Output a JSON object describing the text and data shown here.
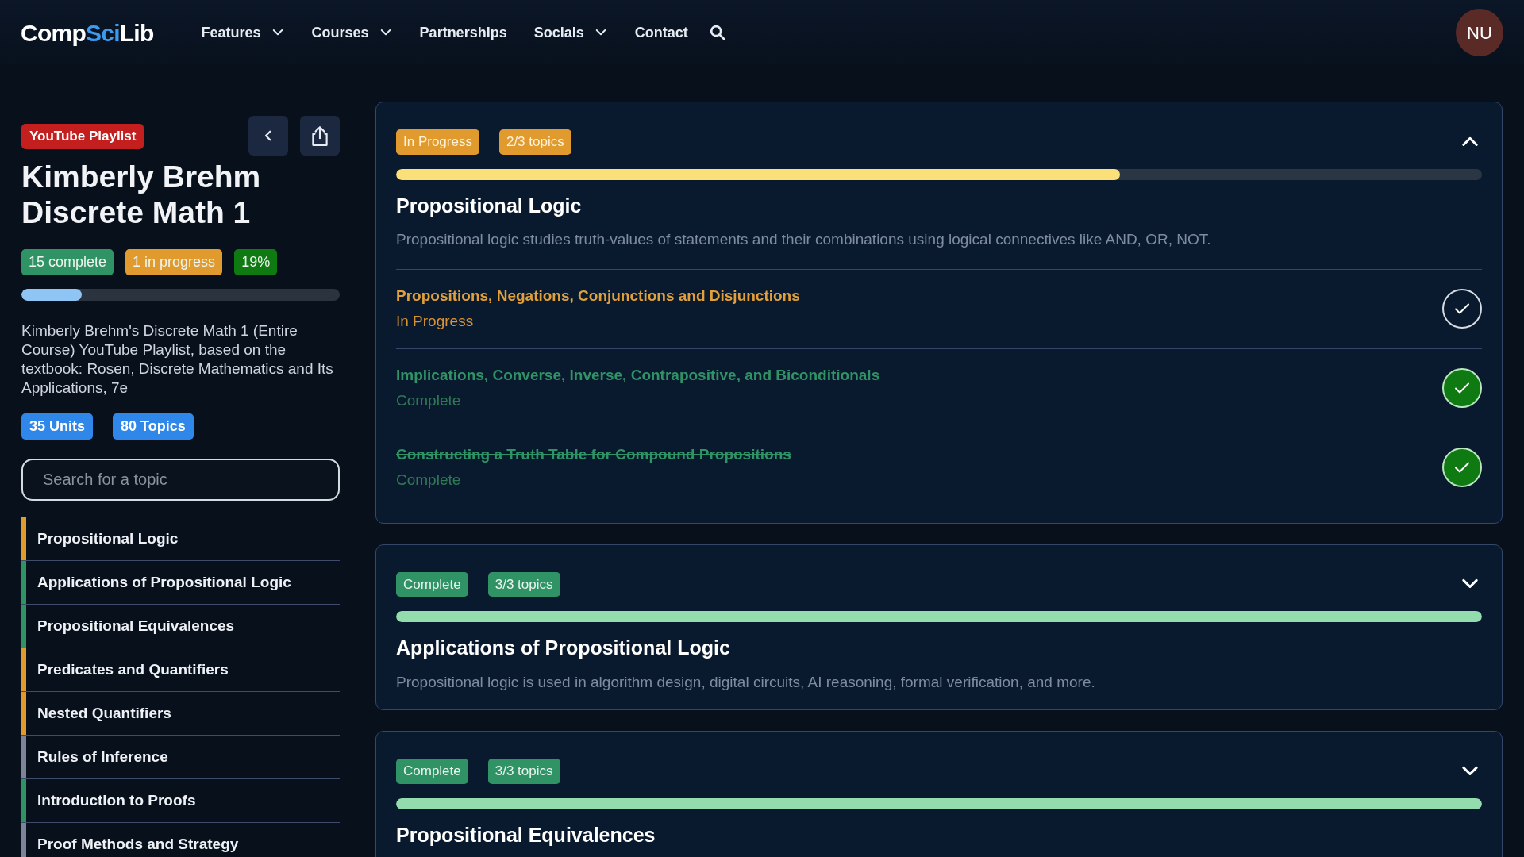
{
  "header": {
    "logo": [
      "Comp",
      "Sci",
      "Lib"
    ],
    "nav": [
      {
        "label": "Features",
        "dropdown": true
      },
      {
        "label": "Courses",
        "dropdown": true
      },
      {
        "label": "Partnerships",
        "dropdown": false
      },
      {
        "label": "Socials",
        "dropdown": true
      },
      {
        "label": "Contact",
        "dropdown": false
      }
    ],
    "avatar": "NU"
  },
  "sidebar": {
    "badge": "YouTube Playlist",
    "title": "Kimberly Brehm Discrete Math 1",
    "stats": [
      {
        "label": "15 complete",
        "color": "#2f9366"
      },
      {
        "label": "1 in progress",
        "color": "#e09a2e"
      },
      {
        "label": "19%",
        "color": "#0f7a12"
      }
    ],
    "level": 0.19,
    "description": "Kimberly Brehm's Discrete Math 1 (Entire Course) YouTube Playlist, based on the textbook: Rosen, Discrete Mathematics and Its Applications, 7e",
    "counts": [
      "35 Units",
      "80 Topics"
    ],
    "search": {
      "placeholder": "Search for a topic"
    },
    "items": [
      {
        "label": "Propositional Logic",
        "color": "#e09a2e"
      },
      {
        "label": "Applications of Propositional Logic",
        "color": "#2f9366"
      },
      {
        "label": "Propositional Equivalences",
        "color": "#2f9366"
      },
      {
        "label": "Predicates and Quantifiers",
        "color": "#e09a2e"
      },
      {
        "label": "Nested Quantifiers",
        "color": "#e09a2e"
      },
      {
        "label": "Rules of Inference",
        "color": "#7b8597"
      },
      {
        "label": "Introduction to Proofs",
        "color": "#2f9366"
      },
      {
        "label": "Proof Methods and Strategy",
        "color": "#7b8597"
      }
    ]
  },
  "units": [
    {
      "kind": "in_progress",
      "status_label": "In Progress",
      "count": "2/3 topics",
      "level": 0.667,
      "expanded": true,
      "title": "Propositional Logic",
      "description": "Propositional logic studies truth-values of statements and their combinations using logical connectives like AND, OR, NOT.",
      "topics": [
        {
          "title": "Propositions, Negations, Conjunctions and Disjunctions",
          "kind": "in_progress",
          "status_label": "In Progress"
        },
        {
          "title": "Implications, Converse, Inverse, Contrapositive, and Biconditionals",
          "kind": "complete",
          "status_label": "Complete"
        },
        {
          "title": "Constructing a Truth Table for Compound Propositions",
          "kind": "complete",
          "status_label": "Complete"
        }
      ]
    },
    {
      "kind": "complete",
      "status_label": "Complete",
      "count": "3/3 topics",
      "level": 1,
      "expanded": false,
      "title": "Applications of Propositional Logic",
      "description": "Propositional logic is used in algorithm design, digital circuits, AI reasoning, formal verification, and more."
    },
    {
      "kind": "complete",
      "status_label": "Complete",
      "count": "3/3 topics",
      "level": 1,
      "expanded": false,
      "title": "Propositional Equivalences"
    }
  ]
}
